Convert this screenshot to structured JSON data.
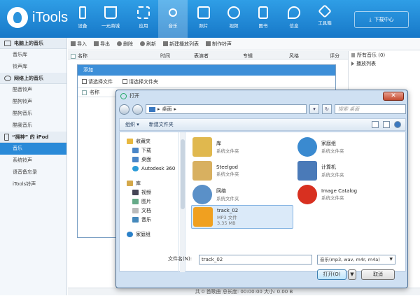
{
  "app": {
    "logo_text": "iTools"
  },
  "nav": [
    {
      "label": "设备",
      "icon": "phone-icon"
    },
    {
      "label": "一元商城",
      "icon": "cart-icon"
    },
    {
      "label": "应用",
      "icon": "apps-icon"
    },
    {
      "label": "音乐",
      "icon": "music-icon",
      "active": true
    },
    {
      "label": "照片",
      "icon": "photo-icon"
    },
    {
      "label": "视频",
      "icon": "video-icon"
    },
    {
      "label": "图书",
      "icon": "book-icon"
    },
    {
      "label": "信息",
      "icon": "message-icon"
    },
    {
      "label": "工具箱",
      "icon": "toolbox-icon"
    }
  ],
  "download_center": "下载中心",
  "sidebar": {
    "sections": [
      {
        "title": "电脑上的音乐",
        "items": [
          "音乐库",
          "铃声库"
        ]
      },
      {
        "title": "网络上的音乐",
        "items": [
          "酷音铃声",
          "酷狗铃声",
          "酷狗音乐",
          "酷我音乐"
        ]
      },
      {
        "title": "“拥神” 的 iPod",
        "items": [
          "音乐",
          "系统铃声",
          "语音备忘录",
          "iTools铃声"
        ]
      }
    ],
    "active_item": "音乐"
  },
  "toolbar": {
    "import": "导入",
    "export": "导出",
    "delete": "删除",
    "refresh": "刷新",
    "new_playlist": "新建播放列表",
    "make_ringtone": "制作铃声"
  },
  "columns": [
    "名称",
    "时间",
    "表演者",
    "专辑",
    "风格",
    "评分"
  ],
  "right_panel": [
    "所有音乐 (0)",
    "播放列表"
  ],
  "status": "共 0 首歌曲   总长度: 00:00:00   大小: 0.00 B",
  "add_dialog": {
    "title": "添加",
    "choose_file": "请选择文件",
    "choose_folder": "请选择文件夹",
    "name_col": "名称"
  },
  "open_dialog": {
    "title": "打开",
    "address": "桌面",
    "search_placeholder": "搜索 桌面",
    "organize": "组织 ▾",
    "new_folder": "新建文件夹",
    "tree": [
      {
        "label": "收藏夹",
        "icon": "star-icon",
        "level": 0
      },
      {
        "label": "下载",
        "icon": "download-folder-icon",
        "level": 1
      },
      {
        "label": "桌面",
        "icon": "desktop-icon",
        "level": 1
      },
      {
        "label": "Autodesk 360",
        "icon": "autodesk-icon",
        "level": 1
      },
      {
        "label": "库",
        "icon": "library-icon",
        "level": 0,
        "gap": true
      },
      {
        "label": "视频",
        "icon": "video-folder-icon",
        "level": 1
      },
      {
        "label": "图片",
        "icon": "picture-folder-icon",
        "level": 1
      },
      {
        "label": "文档",
        "icon": "document-folder-icon",
        "level": 1
      },
      {
        "label": "音乐",
        "icon": "music-folder-icon",
        "level": 1
      },
      {
        "label": "家庭组",
        "icon": "homegroup-icon",
        "level": 0,
        "gap": true
      }
    ],
    "files": [
      {
        "name": "库",
        "type": "系统文件夹",
        "icon": "library-icon",
        "color": "#e0b84e"
      },
      {
        "name": "家庭组",
        "type": "系统文件夹",
        "icon": "homegroup-icon",
        "color": "#3a8ad0"
      },
      {
        "name": "Steelgod",
        "type": "系统文件夹",
        "icon": "user-folder-icon",
        "color": "#d8b060"
      },
      {
        "name": "计算机",
        "type": "系统文件夹",
        "icon": "computer-icon",
        "color": "#4a7ab8"
      },
      {
        "name": "网络",
        "type": "系统文件夹",
        "icon": "network-icon",
        "color": "#5a90c8"
      },
      {
        "name": "Image Catalog",
        "type": "系统文件夹",
        "icon": "image-catalog-icon",
        "color": "#d83020"
      },
      {
        "name": "track_02",
        "type": "MP3 文件",
        "size": "3.35 MB",
        "icon": "mp3-file-icon",
        "color": "#f0a020",
        "selected": true
      }
    ],
    "filename_label": "文件名(N):",
    "filename_value": "track_02",
    "filetype": "音乐(mp3, wav, m4r, m4a)",
    "open_button": "打开(O)",
    "cancel_button": "取消"
  }
}
